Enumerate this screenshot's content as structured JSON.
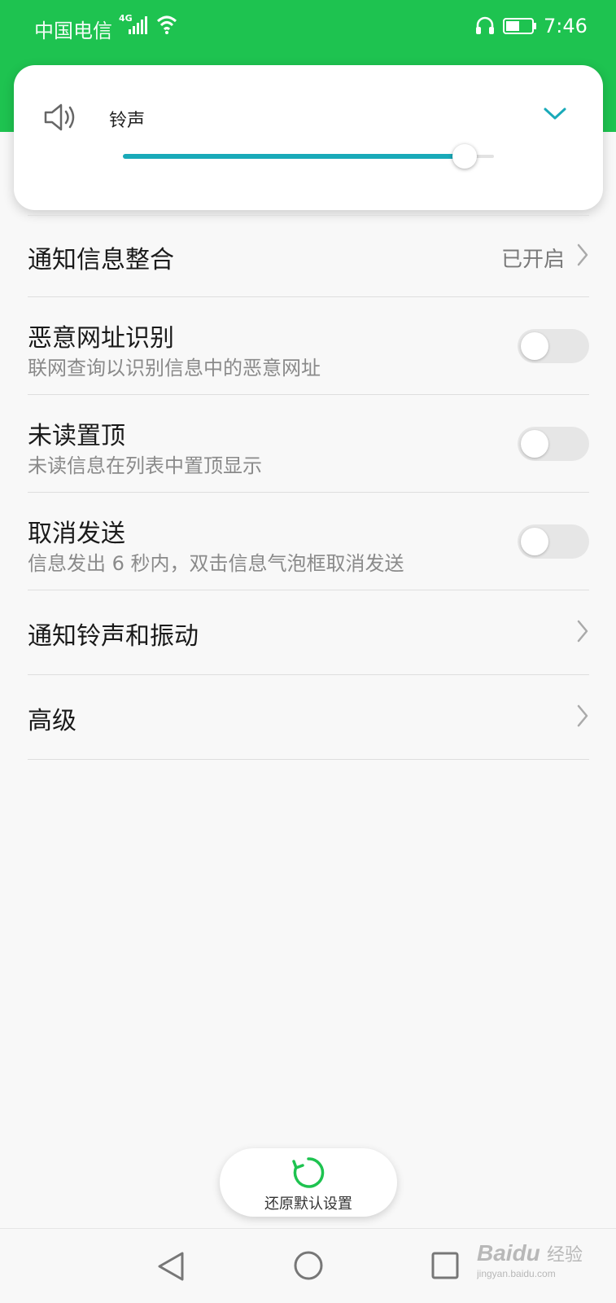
{
  "status_bar": {
    "carrier": "中国电信",
    "network_type": "4G",
    "time": "7:46",
    "icons": [
      "signal-icon",
      "wifi-icon",
      "headphone-icon",
      "battery-icon"
    ]
  },
  "volume_panel": {
    "label": "铃声",
    "level_percent": 92,
    "icons": [
      "speaker-icon",
      "chevron-down-icon"
    ]
  },
  "settings": {
    "notification_merge": {
      "title": "通知信息整合",
      "value": "已开启"
    },
    "malicious_url": {
      "title": "恶意网址识别",
      "subtitle": "联网查询以识别信息中的恶意网址",
      "enabled": false
    },
    "unread_top": {
      "title": "未读置顶",
      "subtitle": "未读信息在列表中置顶显示",
      "enabled": false
    },
    "cancel_send": {
      "title": "取消发送",
      "subtitle": "信息发出 6 秒内，双击信息气泡框取消发送",
      "enabled": false
    },
    "ringtone_vibration": {
      "title": "通知铃声和振动"
    },
    "advanced": {
      "title": "高级"
    }
  },
  "restore_button": {
    "label": "还原默认设置"
  },
  "nav_bar": {
    "icons": [
      "back-icon",
      "home-icon",
      "recent-apps-icon"
    ]
  },
  "colors": {
    "brand_green": "#1ec350",
    "accent_teal": "#19aab9"
  }
}
